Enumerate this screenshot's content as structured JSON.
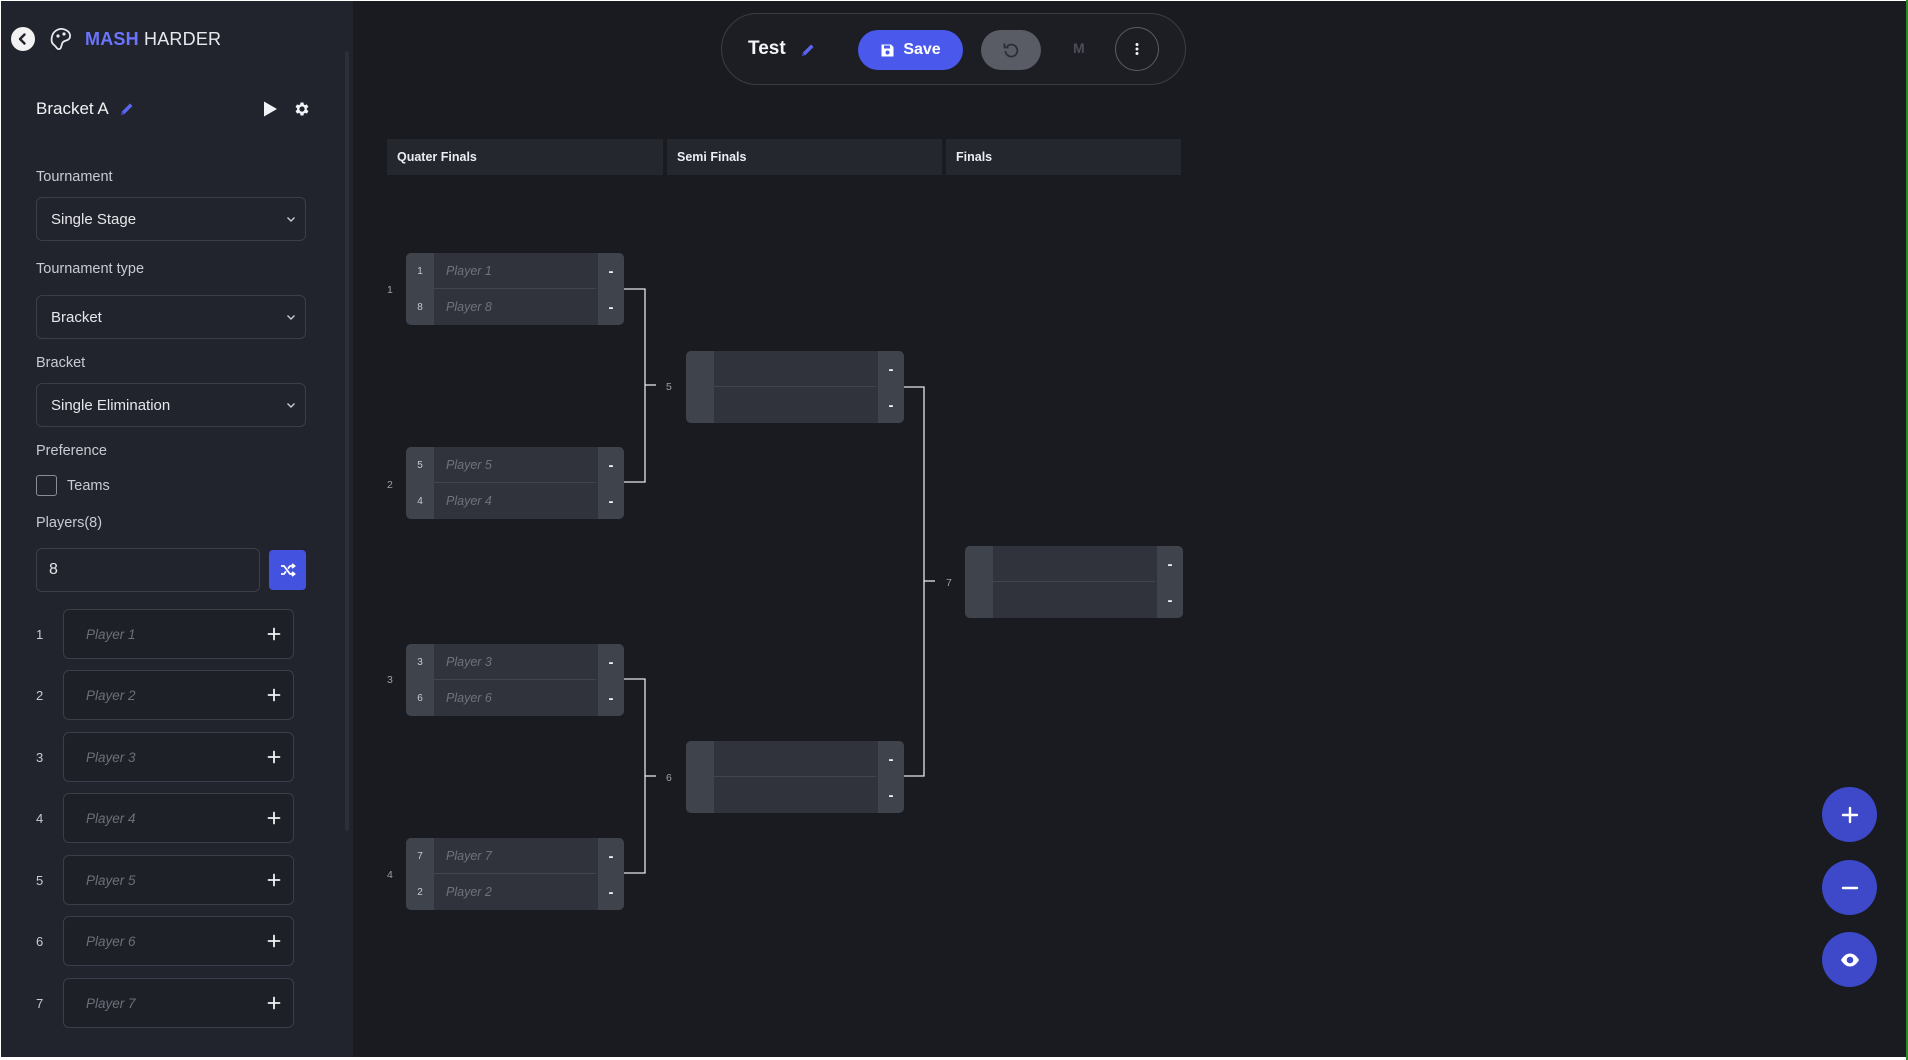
{
  "brand": {
    "part1": "MASH",
    "part2": "HARDER"
  },
  "sidebar": {
    "bracket_title": "Bracket A",
    "tournament_label": "Tournament",
    "tournament_value": "Single Stage",
    "tournament_type_label": "Tournament type",
    "tournament_type_value": "Bracket",
    "bracket_label": "Bracket",
    "bracket_value": "Single Elimination",
    "preference_label": "Preference",
    "teams_label": "Teams",
    "teams_checked": false,
    "players_label": "Players(8)",
    "players_count": "8",
    "players": [
      {
        "num": "1",
        "placeholder": "Player 1"
      },
      {
        "num": "2",
        "placeholder": "Player 2"
      },
      {
        "num": "3",
        "placeholder": "Player 3"
      },
      {
        "num": "4",
        "placeholder": "Player 4"
      },
      {
        "num": "5",
        "placeholder": "Player 5"
      },
      {
        "num": "6",
        "placeholder": "Player 6"
      },
      {
        "num": "7",
        "placeholder": "Player 7"
      }
    ]
  },
  "toolbar": {
    "title": "Test",
    "save_label": "Save",
    "mode_letter": "M"
  },
  "rounds": [
    "Quater Finals",
    "Semi Finals",
    "Finals"
  ],
  "matches": {
    "m1": {
      "label": "1",
      "top": {
        "seed": "1",
        "name": "Player 1",
        "score": "-"
      },
      "bottom": {
        "seed": "8",
        "name": "Player 8",
        "score": "-"
      }
    },
    "m2": {
      "label": "2",
      "top": {
        "seed": "5",
        "name": "Player 5",
        "score": "-"
      },
      "bottom": {
        "seed": "4",
        "name": "Player 4",
        "score": "-"
      }
    },
    "m3": {
      "label": "3",
      "top": {
        "seed": "3",
        "name": "Player 3",
        "score": "-"
      },
      "bottom": {
        "seed": "6",
        "name": "Player 6",
        "score": "-"
      }
    },
    "m4": {
      "label": "4",
      "top": {
        "seed": "7",
        "name": "Player 7",
        "score": "-"
      },
      "bottom": {
        "seed": "2",
        "name": "Player 2",
        "score": "-"
      }
    },
    "m5": {
      "label": "5",
      "top": {
        "seed": "",
        "name": "",
        "score": "-"
      },
      "bottom": {
        "seed": "",
        "name": "",
        "score": "-"
      }
    },
    "m6": {
      "label": "6",
      "top": {
        "seed": "",
        "name": "",
        "score": "-"
      },
      "bottom": {
        "seed": "",
        "name": "",
        "score": "-"
      }
    },
    "m7": {
      "label": "7",
      "top": {
        "seed": "",
        "name": "",
        "score": "-"
      },
      "bottom": {
        "seed": "",
        "name": "",
        "score": "-"
      }
    }
  },
  "icons": {
    "back": "arrow-left-circle-icon",
    "logo": "gamepad-logo-icon",
    "edit": "pencil-icon",
    "play": "play-icon",
    "settings": "gear-icon",
    "shuffle": "shuffle-icon",
    "add": "plus-icon",
    "save": "floppy-disk-icon",
    "undo": "undo-icon",
    "more": "more-vertical-icon",
    "zoom_in": "plus-icon",
    "zoom_out": "minus-icon",
    "view": "eye-icon"
  },
  "colors": {
    "accent": "#4a58ec",
    "background": "#191b21",
    "sidebar": "#21242c",
    "brand": "#6b74ff"
  }
}
